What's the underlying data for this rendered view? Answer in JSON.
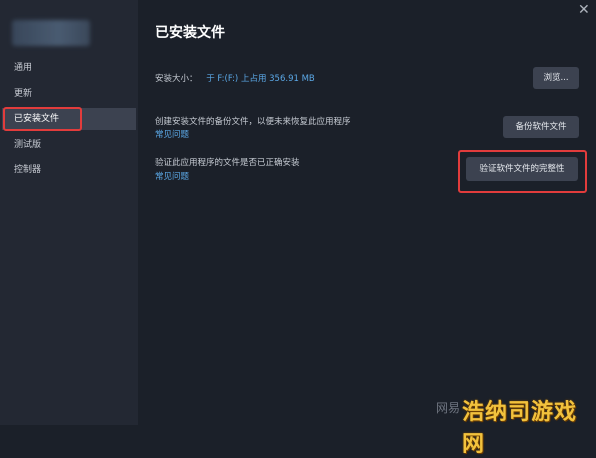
{
  "title": "已安装文件",
  "sidebar": {
    "items": [
      {
        "label": "通用"
      },
      {
        "label": "更新"
      },
      {
        "label": "已安装文件"
      },
      {
        "label": "测试版"
      },
      {
        "label": "控制器"
      }
    ]
  },
  "install_size": {
    "label": "安装大小：",
    "value": "于 F:(F:) 上占用 356.91 MB",
    "button": "浏览..."
  },
  "backup": {
    "description": "创建安装文件的备份文件，以便未来恢复此应用程序",
    "link": "常见问题",
    "button": "备份软件文件"
  },
  "verify": {
    "description": "验证此应用程序的文件是否已正确安装",
    "link": "常见问题",
    "button": "验证软件文件的完整性"
  },
  "watermark": {
    "text1": "网易",
    "text2": "浩纳司游戏网"
  },
  "colors": {
    "highlight": "#e23c3c",
    "link": "#5ba8e6",
    "background": "#1b2029"
  }
}
